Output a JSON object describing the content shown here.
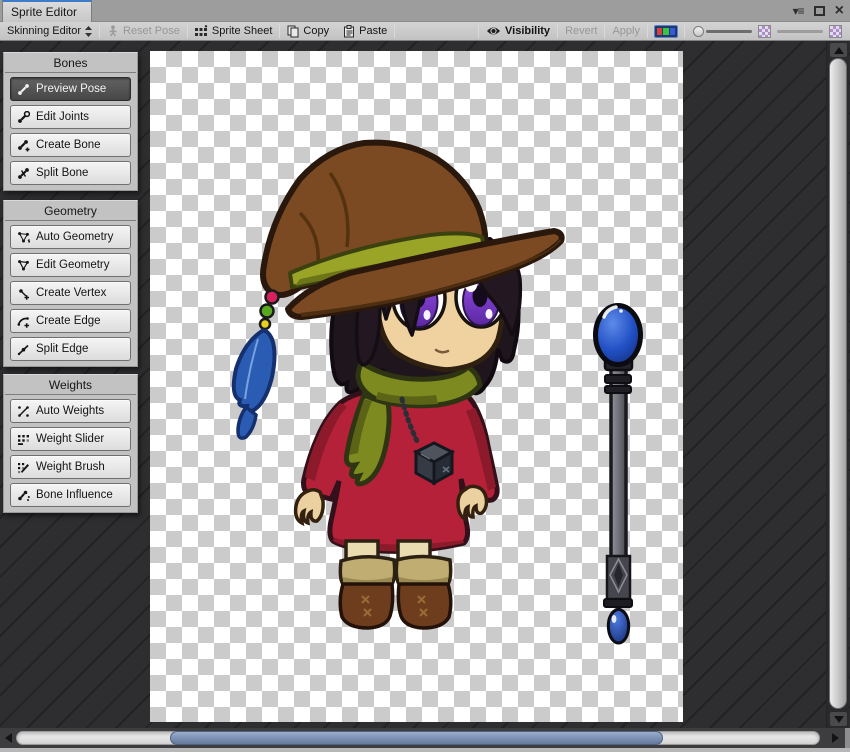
{
  "window": {
    "tab_title": "Sprite Editor",
    "controls": {
      "menu_glyph": "▾≡",
      "close_glyph": "×"
    }
  },
  "toolbar": {
    "mode": "Skinning Editor",
    "reset_pose": "Reset Pose",
    "sprite_sheet": "Sprite Sheet",
    "copy": "Copy",
    "paste": "Paste",
    "visibility": "Visibility",
    "revert": "Revert",
    "apply": "Apply",
    "disabled_items": [
      "Reset Pose",
      "Revert",
      "Apply"
    ]
  },
  "panels": [
    {
      "title": "Bones",
      "buttons": [
        {
          "label": "Preview Pose",
          "icon": "preview-pose-icon",
          "selected": true
        },
        {
          "label": "Edit Joints",
          "icon": "edit-joints-icon",
          "selected": false
        },
        {
          "label": "Create Bone",
          "icon": "create-bone-icon",
          "selected": false
        },
        {
          "label": "Split Bone",
          "icon": "split-bone-icon",
          "selected": false
        }
      ]
    },
    {
      "title": "Geometry",
      "buttons": [
        {
          "label": "Auto Geometry",
          "icon": "auto-geometry-icon",
          "selected": false
        },
        {
          "label": "Edit Geometry",
          "icon": "edit-geometry-icon",
          "selected": false
        },
        {
          "label": "Create Vertex",
          "icon": "create-vertex-icon",
          "selected": false
        },
        {
          "label": "Create Edge",
          "icon": "create-edge-icon",
          "selected": false
        },
        {
          "label": "Split Edge",
          "icon": "split-edge-icon",
          "selected": false
        }
      ]
    },
    {
      "title": "Weights",
      "buttons": [
        {
          "label": "Auto Weights",
          "icon": "auto-weights-icon",
          "selected": false
        },
        {
          "label": "Weight Slider",
          "icon": "weight-slider-icon",
          "selected": false
        },
        {
          "label": "Weight Brush",
          "icon": "weight-brush-icon",
          "selected": false
        },
        {
          "label": "Bone Influence",
          "icon": "bone-influence-icon",
          "selected": false
        }
      ]
    }
  ],
  "canvas": {
    "content": "chibi witch girl sprite with feathered hat, red dress, Unity-cube pendant, and a blue-orb staff on transparency checkerboard"
  },
  "colors": {
    "tab_accent_blue": "#3e7cc8",
    "selected_tool_button": "#4f4f4f",
    "checker_gray": "#cbcbcb",
    "hscroll_thumb_blue": "#7d93b4",
    "hat_brown": "#7b4a22",
    "band_olive": "#9aa427",
    "dress_red": "#b42138",
    "scarf_olive": "#7c8a1f",
    "eye_purple": "#7a3cc8",
    "feather_blue": "#2a5cb4",
    "orb_blue": "#2150c4",
    "skin_tan": "#efd2a0"
  }
}
